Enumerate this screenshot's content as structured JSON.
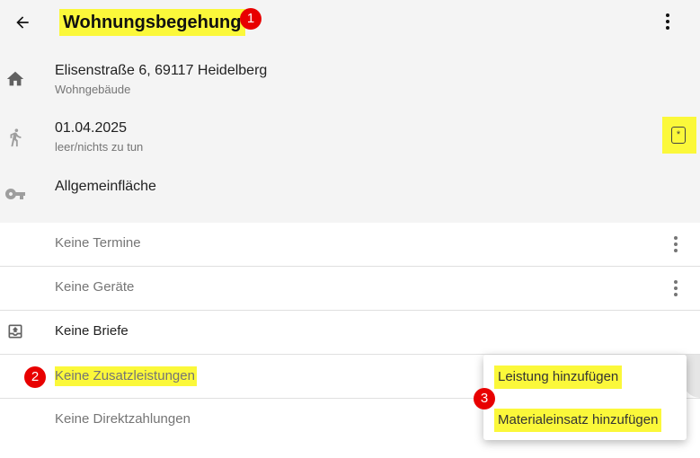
{
  "header": {
    "title": "Wohnungsbegehung",
    "title_badge": "1",
    "back_icon": "arrow-left-icon",
    "menu_icon": "more-vertical-icon"
  },
  "info": {
    "address": "Elisenstraße 6, 69117 Heidelberg",
    "building_type": "Wohngebäude",
    "date": "01.04.2025",
    "status": "leer/nichts zu tun",
    "note_button_label": "*",
    "area": "Allgemeinfläche"
  },
  "rows": {
    "termine": "Keine Termine",
    "geraete": "Keine Geräte",
    "briefe": "Keine Briefe",
    "zusatzleistungen": "Keine Zusatzleistungen",
    "zusatzleistungen_badge": "2",
    "direktzahlungen": "Keine Direktzahlungen"
  },
  "menu": {
    "item_1": "Leistung hinzufügen",
    "item_2": "Materialeinsatz hinzufügen",
    "badge": "3"
  },
  "colors": {
    "highlight": "#fbf83a",
    "badge": "#e80000",
    "header_bg": "#f4f4f4"
  }
}
